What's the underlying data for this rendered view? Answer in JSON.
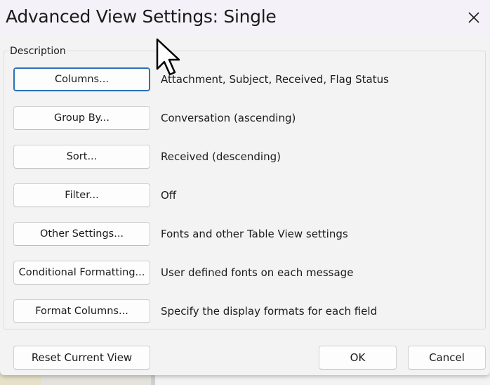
{
  "window": {
    "title": "Advanced View Settings: Single"
  },
  "description_group": {
    "label": "Description",
    "rows": [
      {
        "button_label": "Columns...",
        "description": "Attachment, Subject, Received, Flag Status"
      },
      {
        "button_label": "Group By...",
        "description": "Conversation (ascending)"
      },
      {
        "button_label": "Sort...",
        "description": "Received (descending)"
      },
      {
        "button_label": "Filter...",
        "description": "Off"
      },
      {
        "button_label": "Other Settings...",
        "description": "Fonts and other Table View settings"
      },
      {
        "button_label": "Conditional Formatting...",
        "description": "User defined fonts on each message"
      },
      {
        "button_label": "Format Columns...",
        "description": "Specify the display formats for each field"
      }
    ]
  },
  "footer": {
    "reset_label": "Reset Current View",
    "ok_label": "OK",
    "cancel_label": "Cancel"
  },
  "icons": {
    "close": "close-icon",
    "cursor": "mouse-pointer-icon"
  },
  "colors": {
    "focus_border": "#2a6fb8",
    "dialog_background": "#f3f3f3",
    "titlebar_background": "#f4f1f8"
  }
}
